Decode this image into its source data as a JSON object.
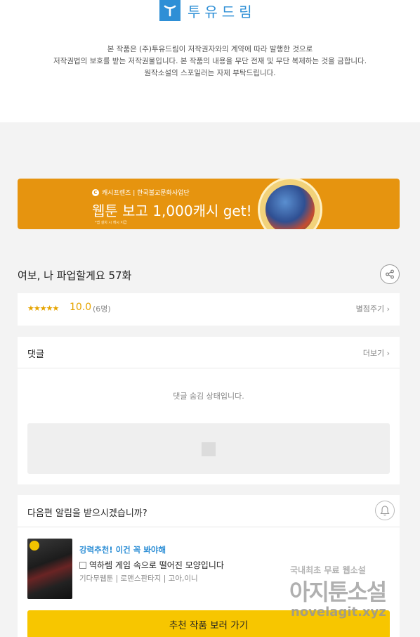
{
  "brand": {
    "name": "투유드림",
    "color": "#2e8fd6"
  },
  "notice": {
    "line1": "본 작품은 (주)투유드림이 저작권자와의 계약에 따라 발행한 것으로",
    "line2": "저작권법의 보호를 받는 저작권물입니다. 본 작품의 내용을 무단 전재 및 무단 복제하는 것을 금합니다.",
    "line3": "원작소설의 스포일러는 자제 부탁드립니다."
  },
  "banner": {
    "brand": "캐시프렌즈 | 한국불교문화사업단",
    "title": "웹툰 보고 1,000캐시 get!",
    "fine_print": "*앱 설치 시 캐시 지급",
    "color": "#e6940f"
  },
  "episode": {
    "title": "여보, 나 파업할게요 57화"
  },
  "rating": {
    "stars": "★★★★★",
    "score": "10.0",
    "count": "(6명)",
    "action": "별점주기 ›"
  },
  "comments": {
    "title": "댓글",
    "more": "더보기 ›",
    "hidden_message": "댓글 숨김 상태입니다."
  },
  "notify": {
    "question": "다음편 알림을 받으시겠습니까?",
    "recommend_label": "강력추천! 이건 꼭 봐야해",
    "recommend_title": "역하렘 게임 속으로 떨어진 모양입니다",
    "recommend_meta": "기다무웹툰 | 로맨스판타지 | 고아,이니",
    "button": "추천 작품 보러 가기",
    "button_color": "#f7c600"
  },
  "watermark": {
    "line1": "국내최초 무료 웹소설",
    "line2": "아지툰소설",
    "line3": "novelagit.xyz"
  }
}
